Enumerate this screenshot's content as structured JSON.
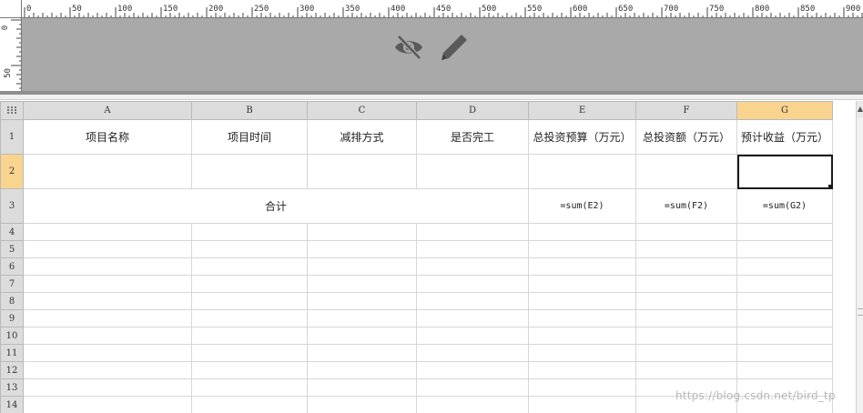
{
  "ruler": {
    "top_labels": [
      "0",
      "50",
      "100",
      "150",
      "200",
      "250",
      "300",
      "350",
      "400",
      "450",
      "500",
      "550",
      "600",
      "650",
      "700",
      "750",
      "800",
      "850",
      "900"
    ],
    "left_labels": [
      "0",
      "50"
    ]
  },
  "toolbar": {
    "hide_icon": "eye-slash-icon",
    "edit_icon": "pencil-icon",
    "icon_color": "#5a5a5a"
  },
  "columns": [
    "A",
    "B",
    "C",
    "D",
    "E",
    "F",
    "G"
  ],
  "active_column": "G",
  "rows": [
    {
      "num": "1",
      "cells": [
        "项目名称",
        "项目时间",
        "减排方式",
        "是否完工",
        "总投资预算（万元）",
        "总投资额（万元）",
        "预计收益（万元）"
      ]
    },
    {
      "num": "2",
      "cells": [
        "",
        "",
        "",
        "",
        "",
        "",
        ""
      ]
    },
    {
      "num": "3",
      "total_label": "合计",
      "formulas": [
        "=sum(E2)",
        "=sum(F2)",
        "=sum(G2)"
      ]
    },
    {
      "num": "4"
    },
    {
      "num": "5"
    },
    {
      "num": "6"
    },
    {
      "num": "7"
    },
    {
      "num": "8"
    },
    {
      "num": "9"
    },
    {
      "num": "10"
    },
    {
      "num": "11"
    },
    {
      "num": "12"
    },
    {
      "num": "13"
    },
    {
      "num": "14"
    }
  ],
  "active_row": "2",
  "selected_cell": "G2",
  "colors": {
    "header_bg": "#a9a9a9",
    "active_header": "#f9d48f",
    "grid_line": "#d6d6d6"
  },
  "watermark": "https://blog.csdn.net/bird_tp"
}
